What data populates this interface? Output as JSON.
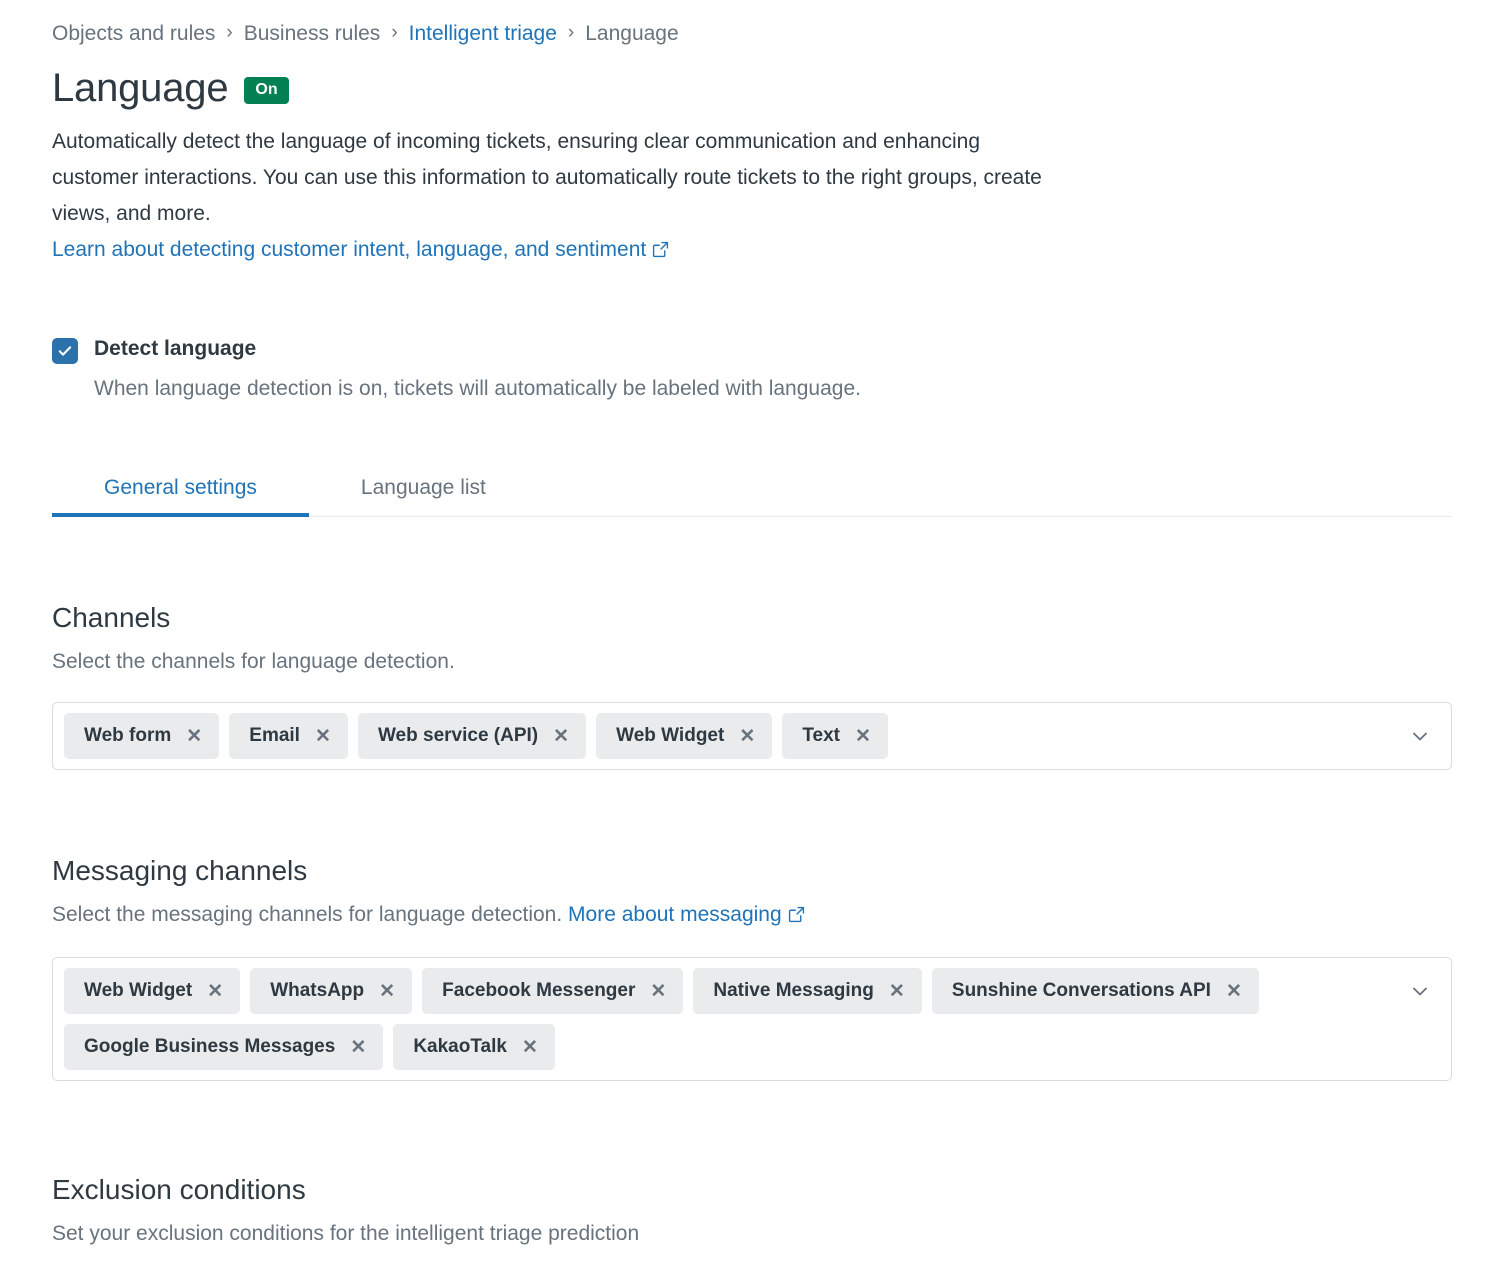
{
  "breadcrumb": {
    "separator": "›",
    "items": [
      {
        "label": "Objects and rules",
        "link": false
      },
      {
        "label": "Business rules",
        "link": false
      },
      {
        "label": "Intelligent triage",
        "link": true
      },
      {
        "label": "Language",
        "link": false
      }
    ]
  },
  "header": {
    "title": "Language",
    "status_badge": "On",
    "badge_color": "#038153",
    "description": "Automatically detect the language of incoming tickets, ensuring clear communication and enhancing customer interactions. You can use this information to automatically route tickets to the right groups, create views, and more.",
    "learn_link": "Learn about detecting customer intent, language, and sentiment",
    "link_color": "#1f73b7"
  },
  "detect_language": {
    "checked": true,
    "label": "Detect language",
    "help": "When language detection is on, tickets will automatically be labeled with language.",
    "checkbox_color": "#2b72ad"
  },
  "tabs": [
    {
      "label": "General settings",
      "active": true
    },
    {
      "label": "Language list",
      "active": false
    }
  ],
  "channels": {
    "title": "Channels",
    "subtitle": "Select the channels for language detection.",
    "chips": [
      {
        "label": "Web form"
      },
      {
        "label": "Email"
      },
      {
        "label": "Web service (API)"
      },
      {
        "label": "Web Widget"
      },
      {
        "label": "Text"
      }
    ]
  },
  "messaging_channels": {
    "title": "Messaging channels",
    "subtitle": "Select the messaging channels for language detection.",
    "more_link": "More about messaging",
    "chips": [
      {
        "label": "Web Widget"
      },
      {
        "label": "WhatsApp"
      },
      {
        "label": "Facebook Messenger"
      },
      {
        "label": "Native Messaging"
      },
      {
        "label": "Sunshine Conversations API"
      },
      {
        "label": "Google Business Messages"
      },
      {
        "label": "KakaoTalk"
      }
    ]
  },
  "exclusion": {
    "title": "Exclusion conditions",
    "subtitle": "Set your exclusion conditions for the intelligent triage prediction"
  },
  "icons": {
    "external_link": "external-link-icon",
    "chevron_down": "chevron-down-icon",
    "check": "check-icon",
    "chip_remove": "close-icon"
  }
}
